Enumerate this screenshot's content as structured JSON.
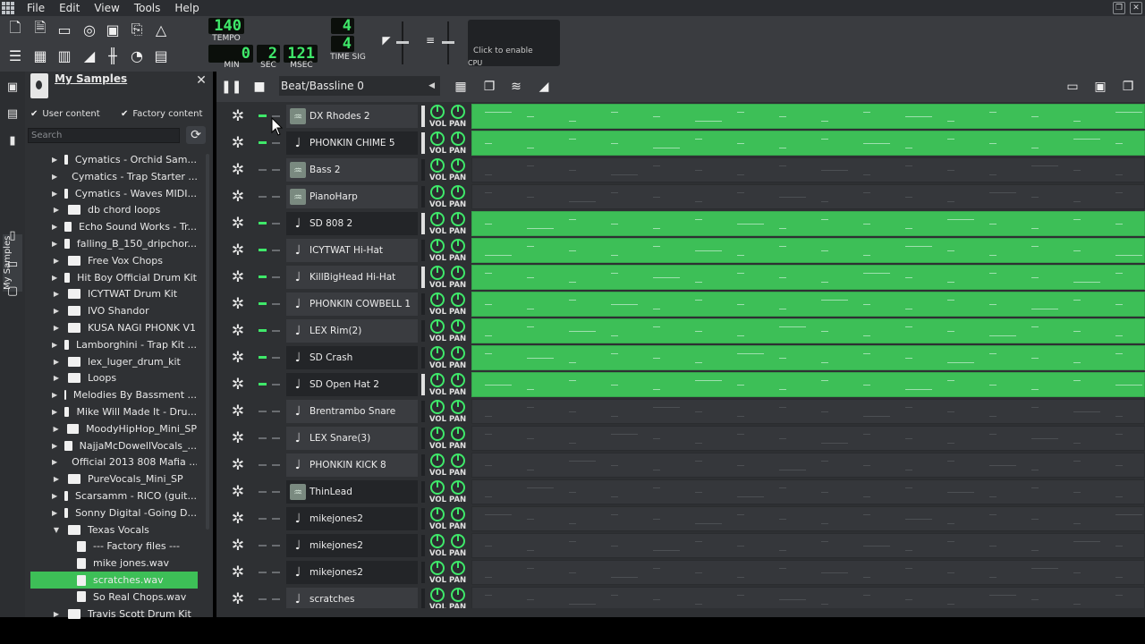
{
  "menu": {
    "items": [
      "File",
      "Edit",
      "View",
      "Tools",
      "Help"
    ]
  },
  "toolbar": {
    "tempo": "140",
    "tempo_label": "TEMPO",
    "time_min": "0",
    "time_sec": "2",
    "time_msec": "121",
    "min_label": "MIN",
    "sec_label": "SEC",
    "msec_label": "MSEC",
    "timesig_num": "4",
    "timesig_den": "4",
    "timesig_label": "TIME SIG",
    "cpu_hint": "Click to enable",
    "cpu_label": "CPU"
  },
  "browser": {
    "title": "My Samples",
    "vertical_tab": "My Samples",
    "user_content": "User content",
    "factory_content": "Factory content",
    "search_placeholder": "Search",
    "items": [
      {
        "label": "Cymatics - Orchid Sam...",
        "type": "folder"
      },
      {
        "label": "Cymatics - Trap Starter ...",
        "type": "folder"
      },
      {
        "label": "Cymatics - Waves MIDI...",
        "type": "folder"
      },
      {
        "label": "db chord loops",
        "type": "folder"
      },
      {
        "label": "Echo Sound Works - Tr...",
        "type": "folder"
      },
      {
        "label": "falling_B_150_dripchor...",
        "type": "folder"
      },
      {
        "label": "Free Vox Chops",
        "type": "folder"
      },
      {
        "label": "Hit Boy Official Drum Kit",
        "type": "folder"
      },
      {
        "label": "ICYTWAT Drum Kit",
        "type": "folder"
      },
      {
        "label": "IVO Shandor",
        "type": "folder"
      },
      {
        "label": "KUSA NAGI PHONK V1",
        "type": "folder"
      },
      {
        "label": "Lamborghini - Trap Kit ...",
        "type": "folder"
      },
      {
        "label": "lex_luger_drum_kit",
        "type": "folder"
      },
      {
        "label": "Loops",
        "type": "folder"
      },
      {
        "label": "Melodies By Bassment ...",
        "type": "folder"
      },
      {
        "label": "Mike Will Made It - Dru...",
        "type": "folder"
      },
      {
        "label": "MoodyHipHop_Mini_SP",
        "type": "folder"
      },
      {
        "label": "NajjaMcDowellVocals_...",
        "type": "folder"
      },
      {
        "label": "Official 2013 808 Mafia ...",
        "type": "folder"
      },
      {
        "label": "PureVocals_Mini_SP",
        "type": "folder"
      },
      {
        "label": "Scarsamm - RICO (guit...",
        "type": "folder"
      },
      {
        "label": "Sonny Digital -Going D...",
        "type": "folder"
      },
      {
        "label": "Texas Vocals",
        "type": "folder-open"
      },
      {
        "label": "--- Factory files ---",
        "type": "file"
      },
      {
        "label": "mike jones.wav",
        "type": "file"
      },
      {
        "label": "scratches.wav",
        "type": "file",
        "selected": true
      },
      {
        "label": "So Real Chops.wav",
        "type": "file"
      },
      {
        "label": "Travis Scott Drum Kit",
        "type": "folder"
      }
    ]
  },
  "editor": {
    "bb_name": "Beat/Bassline 0",
    "vol_label": "VOL",
    "pan_label": "PAN",
    "tracks": [
      {
        "name": "DX Rhodes 2",
        "kind": "synth",
        "active": true
      },
      {
        "name": "PHONKIN CHIME 5",
        "kind": "sample",
        "active": true
      },
      {
        "name": "Bass 2",
        "kind": "synth",
        "active": false
      },
      {
        "name": "PianoHarp",
        "kind": "synth",
        "active": false
      },
      {
        "name": "SD 808 2",
        "kind": "sample",
        "active": true
      },
      {
        "name": "ICYTWAT Hi-Hat",
        "kind": "sample",
        "active": true
      },
      {
        "name": "KillBigHead Hi-Hat",
        "kind": "sample",
        "active": true
      },
      {
        "name": "PHONKIN COWBELL  1",
        "kind": "sample",
        "active": true
      },
      {
        "name": "LEX Rim(2)",
        "kind": "sample",
        "active": true
      },
      {
        "name": "SD Crash",
        "kind": "sample",
        "active": true
      },
      {
        "name": "SD Open Hat 2",
        "kind": "sample",
        "active": true
      },
      {
        "name": "Brentrambo Snare",
        "kind": "sample",
        "active": false
      },
      {
        "name": "LEX Snare(3)",
        "kind": "sample",
        "active": false
      },
      {
        "name": "PHONKIN KICK 8",
        "kind": "sample",
        "active": false
      },
      {
        "name": "ThinLead",
        "kind": "synth",
        "active": false
      },
      {
        "name": "mikejones2",
        "kind": "sample",
        "active": false
      },
      {
        "name": "mikejones2",
        "kind": "sample",
        "active": false
      },
      {
        "name": "mikejones2",
        "kind": "sample",
        "active": false
      },
      {
        "name": "scratches",
        "kind": "sample",
        "active": false
      }
    ]
  },
  "colors": {
    "accent": "#3dbf57",
    "lcd_green": "#3fe86a",
    "panel": "#2e3033"
  }
}
